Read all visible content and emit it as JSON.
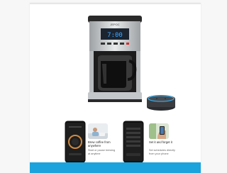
{
  "product": {
    "brand": "JEPOC",
    "display_time": "7:00",
    "icon": "coffee-maker-icon"
  },
  "speaker": {
    "icon": "smart-speaker-icon"
  },
  "features": [
    {
      "title": "Brew coffee from anywhere",
      "body": "Start or pause brewing at anytime"
    },
    {
      "title": "Set it and forget it",
      "body": "Set schedules directly from your phone"
    }
  ],
  "colors": {
    "accent_bar": "#1aa3dc",
    "display": "#3fa7ff",
    "speaker_ring": "#2fb5ff"
  }
}
